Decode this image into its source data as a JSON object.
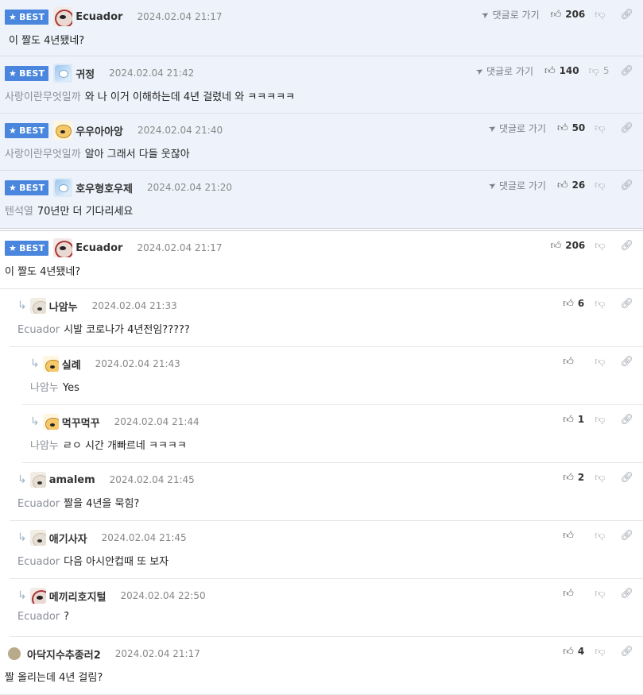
{
  "best": {
    "badge": "BEST",
    "goto_label": "댓글로 가기",
    "items": [
      {
        "nick": "Ecuador",
        "date": "2024.02.04 21:17",
        "mention": "",
        "text": "이 짤도 4년됐네?",
        "likes": "206",
        "dislikes": ""
      },
      {
        "nick": "귀정",
        "date": "2024.02.04 21:42",
        "mention": "사랑이란무엇일까",
        "text": "와 나 이거 이해하는데 4년 걸렸네 와 ㅋㅋㅋㅋㅋ",
        "likes": "140",
        "dislikes": "5"
      },
      {
        "nick": "우우아아앙",
        "date": "2024.02.04 21:40",
        "mention": "사랑이란무엇일까",
        "text": "알아 그래서 다들 웃잖아",
        "likes": "50",
        "dislikes": ""
      },
      {
        "nick": "호우형호우제",
        "date": "2024.02.04 21:20",
        "mention": "텐석열",
        "text": "70년만 더 기다리세요",
        "likes": "26",
        "dislikes": ""
      }
    ]
  },
  "comments": [
    {
      "nick": "Ecuador",
      "badge": "BEST",
      "date": "2024.02.04 21:17",
      "mention": "",
      "text": "이 짤도 4년됐네?",
      "likes": "206"
    },
    {
      "nick": "나암누",
      "date": "2024.02.04 21:33",
      "mention": "Ecuador",
      "text": "시발 코로나가 4년전임?????",
      "likes": "6"
    },
    {
      "nick": "실례",
      "date": "2024.02.04 21:43",
      "mention": "나암누",
      "text": "Yes",
      "likes": ""
    },
    {
      "nick": "먹꾸먹꾸",
      "date": "2024.02.04 21:44",
      "mention": "나암누",
      "text": "ㄹㅇ 시간 개빠르네 ㅋㅋㅋㅋ",
      "likes": "1"
    },
    {
      "nick": "amalem",
      "date": "2024.02.04 21:45",
      "mention": "Ecuador",
      "text": "짤을 4년을 묵힘?",
      "likes": "2"
    },
    {
      "nick": "애기사자",
      "date": "2024.02.04 21:45",
      "mention": "Ecuador",
      "text": "다음 아시안컵때 또 보자",
      "likes": ""
    },
    {
      "nick": "메끼리호지털",
      "date": "2024.02.04 22:50",
      "mention": "Ecuador",
      "text": "?",
      "likes": ""
    },
    {
      "nick": "아닥지수추종러2",
      "date": "2024.02.04 21:17",
      "mention": "",
      "text": "짤 올리는데 4년 걸림?",
      "likes": "4"
    }
  ],
  "icons": {
    "like": "thumbs-up-icon",
    "dislike": "thumbs-down-icon",
    "link": "link-icon",
    "goto": "send-arrow-icon",
    "star": "star-icon",
    "reply": "reply-arrow-icon"
  },
  "colors": {
    "best_badge": "#4a86dd",
    "best_bg": "#eef3fb",
    "mention": "#8a8f98"
  }
}
